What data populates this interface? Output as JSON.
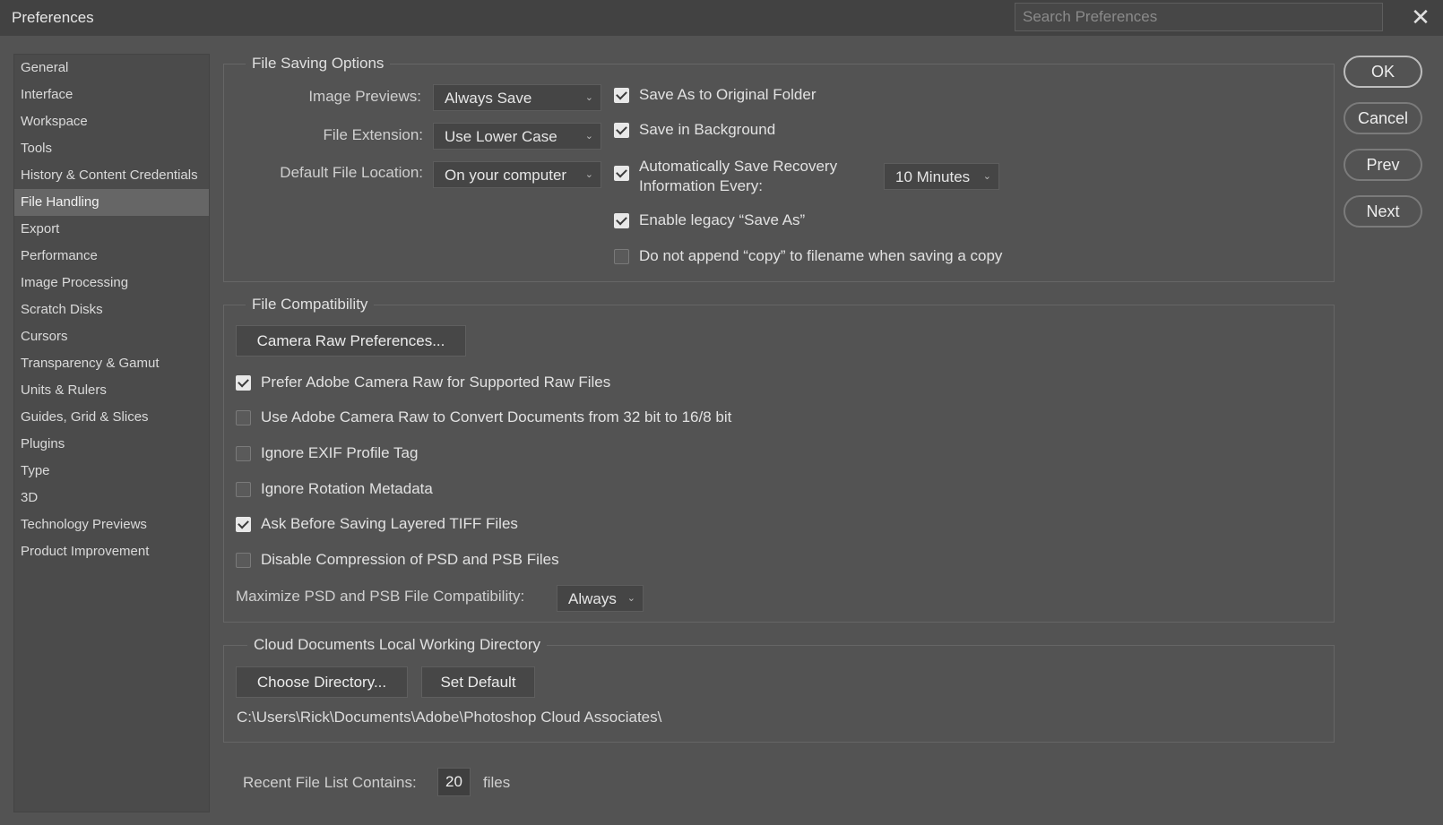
{
  "window": {
    "title": "Preferences",
    "search_placeholder": "Search Preferences",
    "close_glyph": "✕"
  },
  "sidebar": {
    "items": [
      {
        "label": "General"
      },
      {
        "label": "Interface"
      },
      {
        "label": "Workspace"
      },
      {
        "label": "Tools"
      },
      {
        "label": "History & Content Credentials"
      },
      {
        "label": "File Handling",
        "selected": true
      },
      {
        "label": "Export"
      },
      {
        "label": "Performance"
      },
      {
        "label": "Image Processing"
      },
      {
        "label": "Scratch Disks"
      },
      {
        "label": "Cursors"
      },
      {
        "label": "Transparency & Gamut"
      },
      {
        "label": "Units & Rulers"
      },
      {
        "label": "Guides, Grid & Slices"
      },
      {
        "label": "Plugins"
      },
      {
        "label": "Type"
      },
      {
        "label": "3D"
      },
      {
        "label": "Technology Previews"
      },
      {
        "label": "Product Improvement"
      }
    ]
  },
  "file_saving": {
    "legend": "File Saving Options",
    "image_previews": {
      "label": "Image Previews:",
      "value": "Always Save"
    },
    "file_extension": {
      "label": "File Extension:",
      "value": "Use Lower Case"
    },
    "default_location": {
      "label": "Default File Location:",
      "value": "On your computer"
    },
    "save_original_folder": {
      "label": "Save As to Original Folder",
      "checked": true
    },
    "save_background": {
      "label": "Save in Background",
      "checked": true
    },
    "auto_recovery": {
      "label_line1": "Automatically Save Recovery",
      "label_line2": "Information Every:",
      "checked": true,
      "interval": "10 Minutes"
    },
    "legacy_save_as": {
      "label": "Enable legacy “Save As”",
      "checked": true
    },
    "no_copy_append": {
      "label": "Do not append “copy” to filename when saving a copy",
      "checked": false
    }
  },
  "file_compat": {
    "legend": "File Compatibility",
    "camera_raw_button": "Camera Raw Preferences...",
    "prefer_acr": {
      "label": "Prefer Adobe Camera Raw for Supported Raw Files",
      "checked": true
    },
    "acr_convert": {
      "label": "Use Adobe Camera Raw to Convert Documents from 32 bit to 16/8 bit",
      "checked": false
    },
    "ignore_exif": {
      "label": "Ignore EXIF Profile Tag",
      "checked": false
    },
    "ignore_rotation": {
      "label": "Ignore Rotation Metadata",
      "checked": false
    },
    "ask_tiff": {
      "label": "Ask Before Saving Layered TIFF Files",
      "checked": true
    },
    "disable_compression": {
      "label": "Disable Compression of PSD and PSB Files",
      "checked": false
    },
    "maximize": {
      "label": "Maximize PSD and PSB File Compatibility:",
      "value": "Always"
    }
  },
  "cloud": {
    "legend": "Cloud Documents Local Working Directory",
    "choose_button": "Choose Directory...",
    "default_button": "Set Default",
    "path": "C:\\Users\\Rick\\Documents\\Adobe\\Photoshop Cloud Associates\\"
  },
  "recent": {
    "label": "Recent File List Contains:",
    "value": "20",
    "suffix": "files"
  },
  "buttons": {
    "ok": "OK",
    "cancel": "Cancel",
    "prev": "Prev",
    "next": "Next"
  }
}
